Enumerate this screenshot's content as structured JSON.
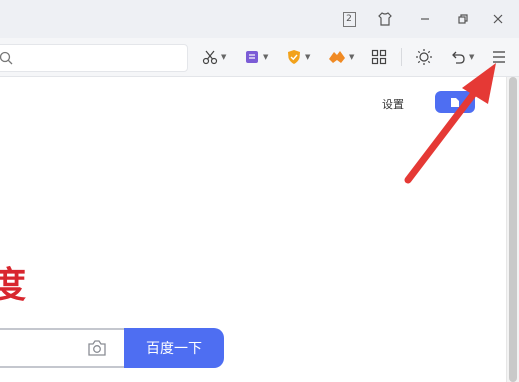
{
  "titlebar": {
    "badge_number": "2",
    "buttons": [
      "skin",
      "minimize",
      "restore",
      "close"
    ]
  },
  "toolbar": {
    "tools": [
      "scissors-icon",
      "notes-icon",
      "shield-icon",
      "game-icon",
      "apps-icon",
      "brightness-icon",
      "undo-icon",
      "menu-icon"
    ]
  },
  "page": {
    "settings_label": "设置",
    "logo_char": "度",
    "search_button_label": "百度一下"
  },
  "colors": {
    "accent": "#4e6ef2",
    "logo_red": "#d8262e",
    "arrow_red": "#e53935"
  }
}
